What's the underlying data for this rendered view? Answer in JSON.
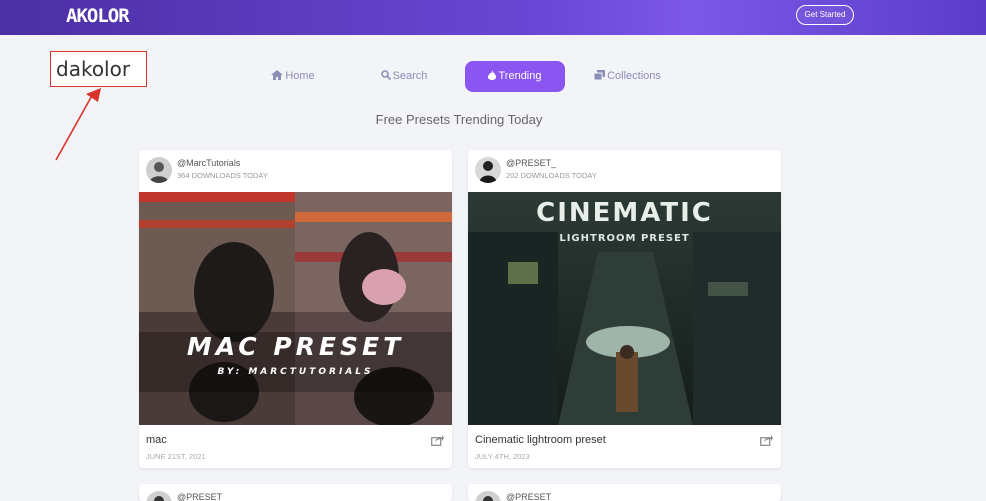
{
  "header": {
    "logo": "AKOLOR",
    "cta": "Get Started"
  },
  "annotation": {
    "label": "dakolor"
  },
  "nav": [
    {
      "label": "Home",
      "icon": "home-icon"
    },
    {
      "label": "Search",
      "icon": "search-icon"
    },
    {
      "label": "Trending",
      "icon": "flame-icon",
      "active": true
    },
    {
      "label": "Collections",
      "icon": "collections-icon"
    }
  ],
  "subtitle": "Free Presets Trending Today",
  "cards": [
    {
      "author": "@MarcTutorials",
      "downloads": "364 DOWNLOADS TODAY",
      "overlay_title": "MAC PRESET",
      "overlay_sub": "BY: MARCTUTORIALS",
      "title": "mac",
      "date": "JUNE 21ST, 2021"
    },
    {
      "author": "@PRESET_",
      "downloads": "202 DOWNLOADS TODAY",
      "overlay_title": "CINEMATIC",
      "overlay_sub": "LIGHTROOM PRESET",
      "title": "Cinematic lightroom preset",
      "date": "JULY 4TH, 2023"
    },
    {
      "author": "@PRESET_"
    },
    {
      "author": "@PRESET_"
    }
  ],
  "colors": {
    "accent": "#8a55f0",
    "header": "#6b47d6",
    "annotation": "#d9342b"
  }
}
